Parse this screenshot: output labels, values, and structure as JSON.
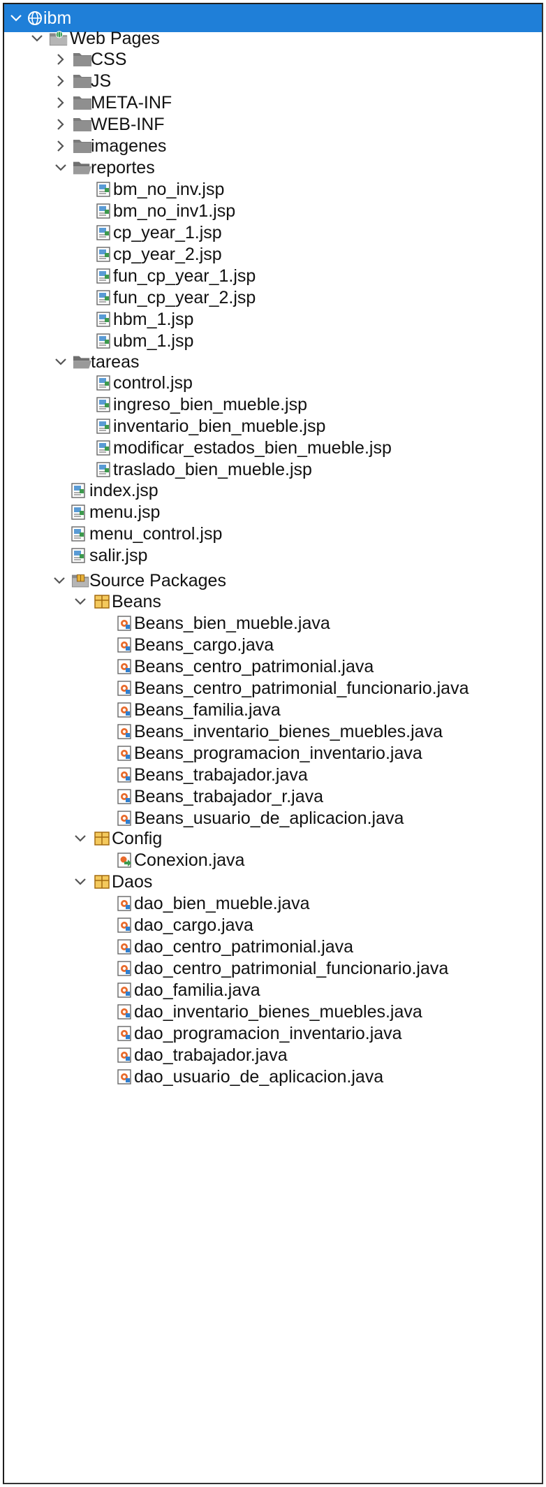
{
  "tree": {
    "project": {
      "label": "ibm"
    },
    "web_pages": {
      "label": "Web Pages",
      "folders": [
        {
          "label": "CSS"
        },
        {
          "label": "JS"
        },
        {
          "label": "META-INF"
        },
        {
          "label": "WEB-INF"
        },
        {
          "label": "imagenes"
        }
      ],
      "reportes": {
        "label": "reportes",
        "files": [
          "bm_no_inv.jsp",
          "bm_no_inv1.jsp",
          "cp_year_1.jsp",
          "cp_year_2.jsp",
          "fun_cp_year_1.jsp",
          "fun_cp_year_2.jsp",
          "hbm_1.jsp",
          "ubm_1.jsp"
        ]
      },
      "tareas": {
        "label": "tareas",
        "files": [
          "control.jsp",
          "ingreso_bien_mueble.jsp",
          "inventario_bien_mueble.jsp",
          "modificar_estados_bien_mueble.jsp",
          "traslado_bien_mueble.jsp"
        ]
      },
      "root_files": [
        "index.jsp",
        "menu.jsp",
        "menu_control.jsp",
        "salir.jsp"
      ]
    },
    "source_packages": {
      "label": "Source Packages",
      "beans": {
        "label": "Beans",
        "files": [
          "Beans_bien_mueble.java",
          "Beans_cargo.java",
          "Beans_centro_patrimonial.java",
          "Beans_centro_patrimonial_funcionario.java",
          "Beans_familia.java",
          "Beans_inventario_bienes_muebles.java",
          "Beans_programacion_inventario.java",
          "Beans_trabajador.java",
          "Beans_trabajador_r.java",
          "Beans_usuario_de_aplicacion.java"
        ]
      },
      "config": {
        "label": "Config",
        "files": [
          "Conexion.java"
        ]
      },
      "daos": {
        "label": "Daos",
        "files": [
          "dao_bien_mueble.java",
          "dao_cargo.java",
          "dao_centro_patrimonial.java",
          "dao_centro_patrimonial_funcionario.java",
          "dao_familia.java",
          "dao_inventario_bienes_muebles.java",
          "dao_programacion_inventario.java",
          "dao_trabajador.java",
          "dao_usuario_de_aplicacion.java"
        ]
      }
    }
  },
  "colors": {
    "selection": "#1f7fd8",
    "folder_gray": "#7a7a7a",
    "package_amber": "#c9891f"
  }
}
